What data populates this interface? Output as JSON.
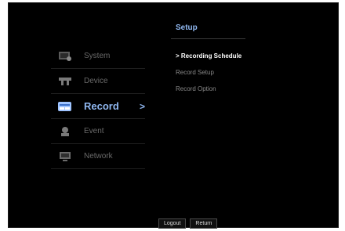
{
  "header": {
    "title": "Setup"
  },
  "sidebar": {
    "items": [
      {
        "label": "System",
        "icon": "system-icon"
      },
      {
        "label": "Device",
        "icon": "device-icon"
      },
      {
        "label": "Record",
        "icon": "record-icon",
        "active": true,
        "chevron": ">"
      },
      {
        "label": "Event",
        "icon": "event-icon"
      },
      {
        "label": "Network",
        "icon": "network-icon"
      }
    ]
  },
  "submenu": {
    "items": [
      {
        "label": "> Recording Schedule",
        "selected": true
      },
      {
        "label": "Record Setup"
      },
      {
        "label": "Record Option"
      }
    ]
  },
  "footer": {
    "logout_label": "Logout",
    "return_label": "Return"
  },
  "colors": {
    "accent": "#8fb7f0",
    "background": "#000000",
    "inactive_text": "#6a6a6a"
  }
}
